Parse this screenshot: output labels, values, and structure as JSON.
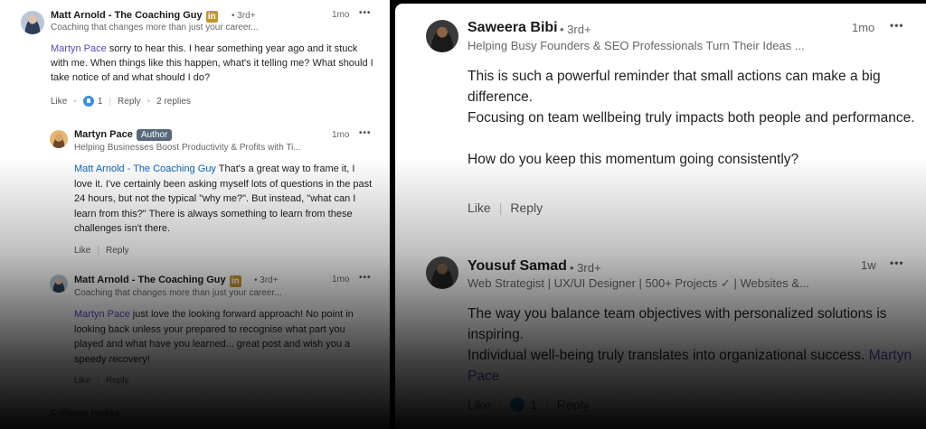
{
  "left": {
    "c1": {
      "name": "Matt Arnold - The Coaching Guy",
      "badge": "in",
      "degree": "• 3rd+",
      "headline": "Coaching that changes more than just your career...",
      "time": "1mo",
      "mention": "Martyn Pace",
      "text": " sorry to hear this. I hear something year ago and it stuck with me. When things like this happen, what's it telling me? What should I take notice of and what should I do?",
      "like": "Like",
      "react_count": "1",
      "reply": "Reply",
      "replies": "2 replies"
    },
    "c2": {
      "name": "Martyn Pace",
      "author": "Author",
      "headline": "Helping Businesses Boost Productivity & Profits with Ti...",
      "time": "1mo",
      "mention": "Matt Arnold - The Coaching Guy",
      "text": " That's a great way to frame it, I love it. I've certainly been asking myself lots of questions in the past 24 hours, but not the typical \"why me?\". But instead, \"what can I learn from this?\" There is always something to learn from these challenges isn't there.",
      "like": "Like",
      "reply": "Reply"
    },
    "c3": {
      "name": "Matt Arnold - The Coaching Guy",
      "badge": "in",
      "degree": "• 3rd+",
      "headline": "Coaching that changes more than just your career...",
      "time": "1mo",
      "mention": "Martyn Pace",
      "text": " just love the looking forward approach! No point in looking back unless your prepared to recognise what part you played and what have you learned... great post and wish you a speedy recovery!",
      "like": "Like",
      "reply": "Reply"
    },
    "collapse": "Collapse replies"
  },
  "right": {
    "c1": {
      "name": "Saweera Bibi",
      "degree": "• 3rd+",
      "headline": "Helping Busy Founders & SEO Professionals Turn Their Ideas ...",
      "time": "1mo",
      "p1": "This is such a powerful reminder that small actions can make a big difference.",
      "p2": "Focusing on team wellbeing truly impacts both people and performance.",
      "p3": "How do you keep this momentum going consistently?",
      "like": "Like",
      "reply": "Reply"
    },
    "c2": {
      "name": "Yousuf Samad",
      "degree": "• 3rd+",
      "headline": "Web Strategist | UX/UI Designer | 500+ Projects ✓ | Websites &...",
      "time": "1w",
      "p1": "The way you balance team objectives with personalized solutions is inspiring.",
      "p2": "Individual well-being truly translates into organizational success. ",
      "mention": "Martyn Pace",
      "like": "Like",
      "react_count": "1",
      "reply": "Reply"
    }
  },
  "more_label": "•••"
}
